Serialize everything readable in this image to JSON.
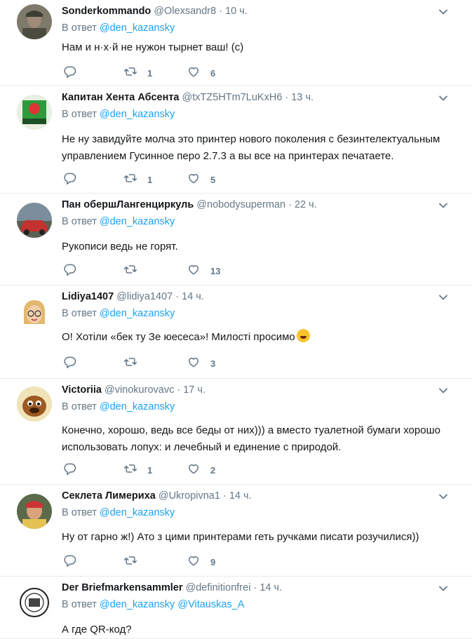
{
  "ui": {
    "reply_prefix": "В ответ",
    "accent": "#1da1f2",
    "muted": "#657786"
  },
  "tweets": [
    {
      "name": "Sonderkommando",
      "handle": "@Olexsandr8",
      "time": "10 ч.",
      "mentions": [
        "@den_kazansky"
      ],
      "text": "Нам и н·х·й не нужон тырнет ваш! (с)",
      "replies": "",
      "retweets": "1",
      "likes": "6",
      "avatar": "soldier-avatar"
    },
    {
      "name": "Капитан Хента Абсента",
      "handle": "@txTZ5HTm7LuKxH6",
      "time": "13 ч.",
      "mentions": [
        "@den_kazansky"
      ],
      "text": "Не ну завидуйте молча это принтер нового поколения с безинтелектуальным управлением Гусинное перо 2.7.3 а вы все на принтерах печатаете.",
      "replies": "",
      "retweets": "1",
      "likes": "5",
      "avatar": "green-logo-avatar"
    },
    {
      "name": "Пан обершЛангенциркуль",
      "handle": "@nobodysuperman",
      "time": "22 ч.",
      "mentions": [
        "@den_kazansky"
      ],
      "text": "Рукописи ведь не горят.",
      "replies": "",
      "retweets": "",
      "likes": "13",
      "avatar": "car-avatar"
    },
    {
      "name": "Lidiya1407",
      "handle": "@lidiya1407",
      "time": "14 ч.",
      "mentions": [
        "@den_kazansky"
      ],
      "text": "О! Хотіли «бек ту Зе юесеса»! Милості просимо",
      "emoji": true,
      "replies": "",
      "retweets": "",
      "likes": "3",
      "avatar": "memoji-avatar"
    },
    {
      "name": "Victoriia",
      "handle": "@vinokurovavc",
      "time": "17 ч.",
      "mentions": [
        "@den_kazansky"
      ],
      "text": "Конечно, хорошо, ведь все беды от них))) а вместо туалетной бумаги хорошо использовать лопух: и лечебный и единение с природой.",
      "replies": "",
      "retweets": "1",
      "likes": "2",
      "avatar": "cartoon-dog-avatar"
    },
    {
      "name": "Секлета Лимериха",
      "handle": "@Ukropivna1",
      "time": "14 ч.",
      "mentions": [
        "@den_kazansky"
      ],
      "text": "Ну от гарно ж!) Ато з цими принтерами геть ручками писати розучилися))",
      "replies": "",
      "retweets": "",
      "likes": "9",
      "avatar": "woman-avatar"
    },
    {
      "name": "Der Briefmarkensammler",
      "handle": "@definitionfrei",
      "time": "14 ч.",
      "mentions": [
        "@den_kazansky",
        "@Vitauskas_A"
      ],
      "text": "А где QR-код?",
      "replies": "",
      "retweets": "",
      "likes": "",
      "avatar": "stamp-avatar"
    }
  ]
}
